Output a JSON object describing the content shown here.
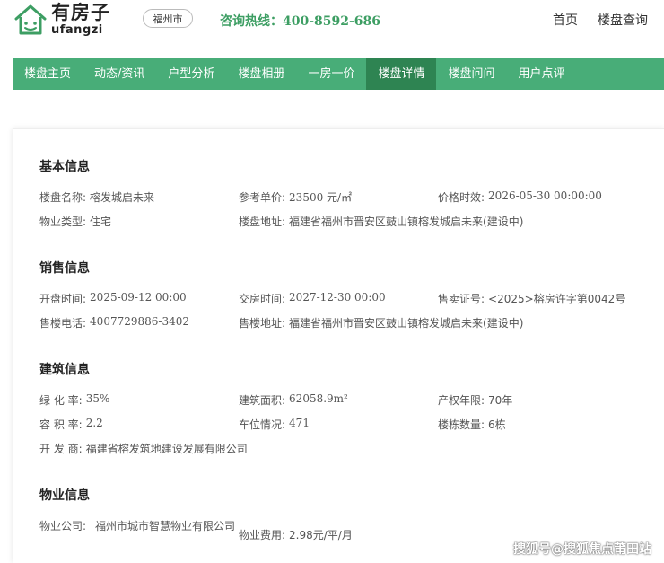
{
  "header": {
    "logo_cn": "有房子",
    "logo_en": "ufangzi",
    "logo_icon": "house-icon",
    "city": "福州市",
    "hotline_label": "咨询热线：",
    "hotline_number": "400-8592-686",
    "nav": [
      "首页",
      "楼盘查询"
    ]
  },
  "navbar": {
    "items": [
      "楼盘主页",
      "动态/资讯",
      "户型分析",
      "楼盘相册",
      "一房一价",
      "楼盘详情",
      "楼盘问问",
      "用户点评"
    ],
    "active_index": 5
  },
  "sections": {
    "basic": {
      "title": "基本信息",
      "name_label": "楼盘名称:",
      "name_value": "榕发城启未来",
      "price_label": "参考单价:",
      "price_value": "23500 元/㎡",
      "validity_label": "价格时效:",
      "validity_value": "2026-05-30 00:00:00",
      "type_label": "物业类型:",
      "type_value": "住宅",
      "address_label": "楼盘地址:",
      "address_value": "福建省福州市晋安区鼓山镇榕发城启未来(建设中)"
    },
    "sales": {
      "title": "销售信息",
      "open_label": "开盘时间:",
      "open_value": "2025-09-12 00:00",
      "delivery_label": "交房时间:",
      "delivery_value": "2027-12-30 00:00",
      "permit_label": "售卖证号:",
      "permit_value": "<2025>榕房许字第0042号",
      "phone_label": "售楼电话:",
      "phone_value": "4007729886-3402",
      "address_label": "售楼地址:",
      "address_value": "福建省福州市晋安区鼓山镇榕发城启未来(建设中)"
    },
    "building": {
      "title": "建筑信息",
      "green_label": "绿 化 率:",
      "green_value": "35%",
      "area_label": "建筑面积:",
      "area_value": "62058.9m²",
      "term_label": "产权年限:",
      "term_value": "70年",
      "ratio_label": "容 积 率:",
      "ratio_value": "2.2",
      "parking_label": "车位情况:",
      "parking_value": "471",
      "count_label": "楼栋数量:",
      "count_value": "6栋",
      "developer_label": "开 发 商:",
      "developer_value": "福建省榕发筑地建设发展有限公司"
    },
    "property": {
      "title": "物业信息",
      "company_label": "物业公司:",
      "company_value": "福州市城市智慧物业有限公司",
      "fee_label": "物业费用:",
      "fee_value": "2.98元/平/月"
    }
  },
  "watermark": "搜狐号@搜狐焦点莆田站"
}
